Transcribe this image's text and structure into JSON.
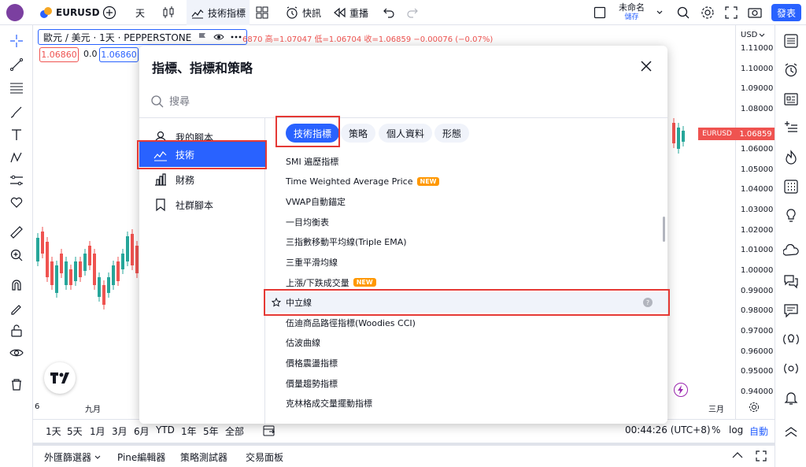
{
  "topbar": {
    "symbol": "EURUSD",
    "interval": "天",
    "indicators_label": "技術指標",
    "alerts_label": "快訊",
    "replay_label": "重播",
    "layout_name": "未命名",
    "layout_sub": "儲存",
    "publish_label": "發表"
  },
  "chart": {
    "legend_title": "歐元 / 美元 · 1天 · PEPPERSTONE",
    "ohlc": "6870  高=1.07047  低=1.06704  收=1.06859  −0.00076 (−0.07%)",
    "sell_price": "1.06860",
    "spread": "0.0",
    "buy_price": "1.06860",
    "currency": "USD",
    "last_price_symbol": "EURUSD",
    "last_price": "1.06859",
    "price_ticks": [
      "1.11000",
      "1.10000",
      "1.09000",
      "1.08000",
      "1.06000",
      "1.05000",
      "1.04000",
      "1.03000",
      "1.02000",
      "1.01000",
      "1.00000",
      "0.99000",
      "0.98000",
      "0.97000",
      "0.96000",
      "0.95000",
      "0.94000"
    ],
    "time_labels": {
      "left": "6",
      "mid": "九月",
      "right": "三月"
    }
  },
  "rangebar": {
    "ranges": [
      "1天",
      "5天",
      "1月",
      "3月",
      "6月",
      "YTD",
      "1年",
      "5年",
      "全部"
    ],
    "clock": "00:44:26 (UTC+8)",
    "percent": "%",
    "log": "log",
    "auto": "自動"
  },
  "paneltabs": {
    "tabs": [
      "外匯篩選器",
      "Pine編輯器",
      "策略測試器",
      "交易面板"
    ]
  },
  "modal": {
    "title": "指標、指標和策略",
    "search_placeholder": "搜尋",
    "sidebar": [
      {
        "label": "我的腳本",
        "icon": "user-icon"
      },
      {
        "label": "技術",
        "icon": "chart-icon"
      },
      {
        "label": "財務",
        "icon": "bar-chart-icon"
      },
      {
        "label": "社群腳本",
        "icon": "bookmark-icon"
      }
    ],
    "chips": [
      "技術指標",
      "策略",
      "個人資料",
      "形態"
    ],
    "items": [
      {
        "label": "SMI 遍歷指標",
        "new": false
      },
      {
        "label": "Time Weighted Average Price",
        "new": true
      },
      {
        "label": "VWAP自動錨定",
        "new": false
      },
      {
        "label": "一目均衡表",
        "new": false
      },
      {
        "label": "三指數移動平均線(Triple EMA)",
        "new": false
      },
      {
        "label": "三重平滑均線",
        "new": false
      },
      {
        "label": "上漲/下跌成交量",
        "new": true
      },
      {
        "label": "中立線",
        "new": false
      },
      {
        "label": "伍迪商品路徑指標(Woodies CCI)",
        "new": false
      },
      {
        "label": "估波曲線",
        "new": false
      },
      {
        "label": "價格震盪指標",
        "new": false
      },
      {
        "label": "價量趨勢指標",
        "new": false
      },
      {
        "label": "克林格成交量擺動指標",
        "new": false
      }
    ],
    "new_badge": "NEW"
  }
}
